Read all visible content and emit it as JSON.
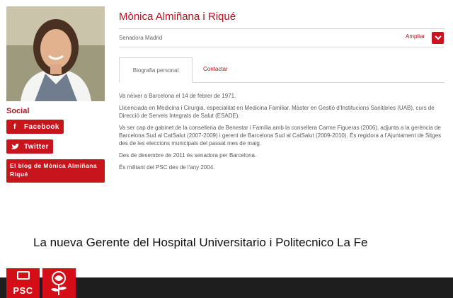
{
  "profile": {
    "name": "Mònica Almiñana i Riqué",
    "subtitle": "Senadora Madrid",
    "expand_label": "Ampliar"
  },
  "social": {
    "title": "Social",
    "facebook_label": "Facebook",
    "twitter_label": "Twitter",
    "blog_label": "El blog de Mònica Almiñana Riqué"
  },
  "tabs": {
    "bio": "Biografia personal",
    "contact": "Contactar"
  },
  "bio": [
    "Va néixer a Barcelona el 14 de febrer de 1971.",
    "Llicenciada en Medicina i Cirurgia, especialitat en Medicina Familiar. Màster en Gestió d'Institucions Sanitàries (UAB), curs de Direcció de Serveis Integrats de Salut (ESADE).",
    "Va ser cap de gabinet de la conselleria de Benestar i Família amb la consellera Carme Figueras (2006), adjunta a la gerència de Barcelona Sud al CatSalut (2007-2009) i gerent de Barcelona Sud al CatSalut (2009-2010). És regidora a l'Ajuntament de Sitges des de les eleccions municipals del passat mes de maig.",
    "Des de desembre de 2011 és senadora per Barcelona.",
    "És militant del PSC des de l'any 2004."
  ],
  "caption": "La nueva Gerente del Hospital Universitario i Politecnico La Fe",
  "footer": {
    "logo_text": "PSC"
  },
  "colors": {
    "accent": "#b3131b",
    "button_red": "#c8141d",
    "footer_dark": "#1e1e1e"
  }
}
